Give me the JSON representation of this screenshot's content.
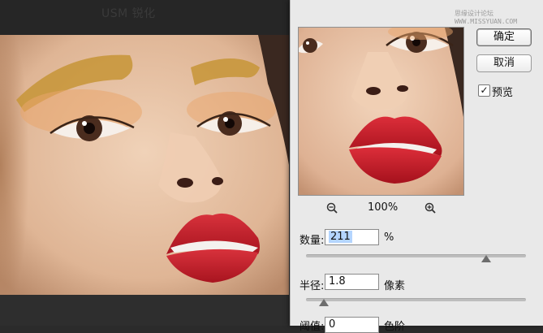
{
  "dialog": {
    "title": "USM 锐化",
    "watermark": "思缘设计论坛 WWW.MISSYUAN.COM",
    "ok_label": "确定",
    "cancel_label": "取消",
    "preview": {
      "label": "预览",
      "checked": true,
      "checkmark": "✓"
    },
    "zoom_level": "100%",
    "fields": {
      "amount": {
        "label": "数量:",
        "value": "211",
        "unit": "%",
        "slider_fraction": 0.82
      },
      "radius": {
        "label": "半径:",
        "value": "1.8",
        "unit": "像素",
        "slider_fraction": 0.08
      },
      "threshold": {
        "label": "阈值:",
        "value": "0",
        "unit": "色阶"
      }
    }
  },
  "icons": [
    "zoom-out-icon",
    "zoom-in-icon",
    "checkbox-check-icon"
  ],
  "colors": {
    "dialog_bg": "#e9e9e9",
    "selection": "#b4d5fe",
    "lip": "#c8222e",
    "skin": "#e6c2a5"
  }
}
